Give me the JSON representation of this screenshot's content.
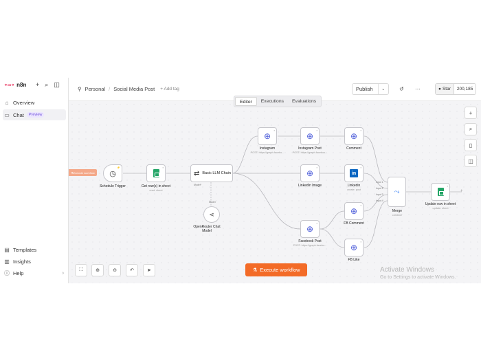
{
  "sidebar": {
    "logo_text": "n8n",
    "items": [
      {
        "label": "Overview"
      },
      {
        "label": "Chat",
        "badge": "Preview"
      },
      {
        "label": "Templates"
      },
      {
        "label": "Insights"
      },
      {
        "label": "Help"
      }
    ]
  },
  "header": {
    "owner": "Personal",
    "workflow_name": "Social Media Post",
    "add_tag": "+ Add tag",
    "publish_label": "Publish",
    "star_label": "Star",
    "star_count": "200,185"
  },
  "tabs": [
    {
      "label": "Editor",
      "active": true
    },
    {
      "label": "Executions"
    },
    {
      "label": "Evaluations"
    }
  ],
  "trigger_tag": "Execute workflow",
  "nodes": {
    "schedule": {
      "label": "Schedule Trigger"
    },
    "get_rows": {
      "label": "Get row(s) in sheet",
      "sub": "read: sheet"
    },
    "llm_chain": {
      "label": "Basic LLM Chain",
      "port_bottom": "Model*"
    },
    "openrouter": {
      "label": "OpenRouter Chat Model",
      "port_top": "Model"
    },
    "instagram": {
      "label": "Instagram",
      "sub": "POST: https://graph.facebo..."
    },
    "instagram_post": {
      "label": "Instagram Post",
      "sub": "POST: https://graph.faceboo..."
    },
    "comment": {
      "label": "Comment"
    },
    "linkedin_image": {
      "label": "LinkedIn Image"
    },
    "linkedin": {
      "label": "Linkedin",
      "sub": "create: post"
    },
    "facebook_post": {
      "label": "Facebook Post",
      "sub": "POST: https://graph.facebo..."
    },
    "fb_comment": {
      "label": "FB Comment"
    },
    "fb_like": {
      "label": "FB Like"
    },
    "merge": {
      "label": "Merge",
      "sub": "combine",
      "inputs": [
        "Input 1",
        "Input 2",
        "Input 3",
        "Input 4"
      ]
    },
    "update_row": {
      "label": "Update row in sheet",
      "sub": "update: sheet"
    }
  },
  "execute_label": "Execute workflow",
  "watermark": {
    "title": "Activate Windows",
    "subtitle": "Go to Settings to activate Windows."
  }
}
